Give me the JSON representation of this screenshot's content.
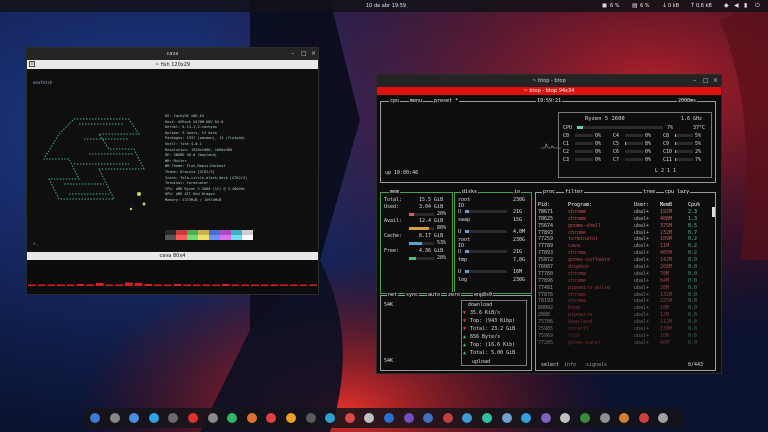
{
  "topbar": {
    "clock": "10 de abr  19:59",
    "indicators": [
      "6 %",
      "6 %",
      "0 kB",
      "0,6 kB"
    ]
  },
  "fish_window": {
    "title": "cava",
    "tab_title": "~ fish 120x29",
    "user_line": "neofetch",
    "cava_tab_title": "cava 80x4",
    "info_lines": [
      "OS: CachyOS x86_64",
      "Host: ASRock X470M-HDV R4.0",
      "Kernel: 6.14.1-2-cachyos",
      "Uptime: 9 hours, 51 mins",
      "Packages: 1937 (pacman), 13 (flatpak)",
      "Shell: fish 4.0.1",
      "Resolution: 1920x1080, 1600x900",
      "DE: GNOME 48.0 (Wayland)",
      "WM: Mutter",
      "WM Theme: Flat-Remix-Darkest",
      "Theme: Dracula [GTK2/3]",
      "Icons: Tela-circle-black-dark [GTK2/3]",
      "Terminal: terminator",
      "CPU: AMD Ryzen 5 2600 (12) @ 3.400GHz",
      "GPU: AMD ATI Red Dragon",
      "Memory: 2373MiB / 15974MiB"
    ],
    "palette": [
      "#2b2b2b",
      "#cc3b3b",
      "#4fae4f",
      "#c9b24a",
      "#4a6fd0",
      "#b04ac0",
      "#3fb0c0",
      "#cfcfcf",
      "#555555",
      "#ff5c5c",
      "#6fdf6f",
      "#f0e070",
      "#6f90ff",
      "#e070f0",
      "#70e0f0",
      "#ffffff"
    ],
    "cava_bars": [
      0.1,
      0.1,
      0.15,
      0.1,
      0.1,
      0.2,
      0.1,
      0.3,
      0.15,
      0.1,
      0.35,
      0.3,
      0.2,
      0.15,
      0.1,
      0.2,
      0.1,
      0.15,
      0.1,
      0.1,
      0.2,
      0.1,
      0.15,
      0.1,
      0.1,
      0.1,
      0.15,
      0.1,
      0.1,
      0.1
    ]
  },
  "btop_window": {
    "title": "~ btop - btop",
    "tab_title": "~ btop - btop 94x34",
    "cpu": {
      "label": "cpu",
      "menu": "menu",
      "preset": "preset *",
      "time": "19:59:21",
      "refresh": "2000ms",
      "model": "Ryzen 5 2600",
      "freq": "1.6 GHz",
      "total_label": "CPU",
      "total_pct": "7%",
      "temp": "37°C",
      "uptime": "up 10:00:46",
      "load": "L 2 1 1",
      "cores": [
        [
          "C0",
          "0%",
          "C4",
          "0%",
          "C8",
          "5%"
        ],
        [
          "C1",
          "0%",
          "C5",
          "8%",
          "C9",
          "5%"
        ],
        [
          "C2",
          "0%",
          "C6",
          "0%",
          "C10",
          "2%"
        ],
        [
          "C3",
          "0%",
          "C7",
          "0%",
          "C11",
          "7%"
        ]
      ]
    },
    "mem": {
      "label": "mem",
      "total_label": "Total:",
      "total": "15.5 GiB",
      "used_label": "Used:",
      "used": "3.04 GiB",
      "used_pct": "20%",
      "avail_label": "Avail:",
      "avail": "12.4 GiB",
      "avail_pct": "80%",
      "cache_label": "Cache:",
      "cache": "8.17 GiB",
      "cache_pct": "53%",
      "free_label": "Free:",
      "free": "4.36 GiB",
      "free_pct": "28%"
    },
    "disks": {
      "label": "disks",
      "io_label": "io",
      "items": [
        {
          "name": "root",
          "size": "230G",
          "io": "IO",
          "u_label": "U",
          "u_val": "21G"
        },
        {
          "name": "swap",
          "size": "15G",
          "io": "",
          "u_label": "U",
          "u_val": "4,0M"
        },
        {
          "name": "root",
          "size": "230G",
          "io": "IO",
          "u_label": "U",
          "u_val": "21G"
        },
        {
          "name": "tmp",
          "size": "7,8G",
          "io": "",
          "u_label": "U",
          "u_val": "16M"
        },
        {
          "name": "log",
          "size": "230G",
          "io": "",
          "u_label": "",
          "u_val": ""
        }
      ]
    },
    "net": {
      "label": "net",
      "sync": "sync",
      "auto": "auto",
      "zero": "zero",
      "iface": "enp8s0",
      "scale_top": "54K",
      "scale_bottom": "54K",
      "download": "download",
      "dl_rate": "35.6 KiB/s",
      "dl_top": "Top: (943 Kibp)",
      "dl_total": "Total: 23.2 GiB",
      "ul_rate": "656 Byte/s",
      "ul_top": "Top: (16.6 Kib)",
      "ul_total": "Total: 5.00 GiB",
      "upload": "upload"
    },
    "proc": {
      "label": "proc",
      "filter": "filter",
      "tree": "tree",
      "sort": "cpu lazy",
      "headers": [
        "Pid:",
        "Program:",
        "User:",
        "MemB",
        "Cpu%"
      ],
      "rows": [
        [
          "78671",
          "chrome",
          "ubal+",
          "192M",
          "2.3"
        ],
        [
          "78625",
          "chrome",
          "ubal+",
          "408M",
          "1.3"
        ],
        [
          "75674",
          "gnome-shell",
          "ubal+",
          "375M",
          "0.5"
        ],
        [
          "77893",
          "chrome",
          "ubal+",
          "232M",
          "0.7"
        ],
        [
          "77259",
          "terminator",
          "ubal+",
          "109M",
          "0.2"
        ],
        [
          "77789",
          "cava",
          "ubal+",
          "11M",
          "0.2"
        ],
        [
          "77893",
          "chrome",
          "ubal+",
          "405M",
          "0.2"
        ],
        [
          "75872",
          "gnome-software",
          "ubal+",
          "142M",
          "0.0"
        ],
        [
          "76087",
          "dropbox",
          "ubal+",
          "268M",
          "0.0"
        ],
        [
          "77760",
          "chrome",
          "ubal+",
          "70M",
          "0.0"
        ],
        [
          "77896",
          "chrome",
          "ubal+",
          "84M",
          "0.0"
        ],
        [
          "77481",
          "pipewire-pulse",
          "ubal+",
          "28M",
          "0.0"
        ],
        [
          "77876",
          "chrome",
          "ubal+",
          "132M",
          "0.0"
        ],
        [
          "78193",
          "chrome",
          "ubal+",
          "225M",
          "0.0"
        ],
        [
          "80092",
          "btop",
          "ubal+",
          "10M",
          "0.0"
        ],
        [
          "2086",
          "pipewire",
          "ubal+",
          "12M",
          "0.0"
        ],
        [
          "75706",
          "Xwayland",
          "ubal+",
          "112M",
          "0.0"
        ],
        [
          "75905",
          "corectl",
          "ubal+",
          "130M",
          "0.0"
        ],
        [
          "75969",
          "fish",
          "ubal+",
          "10M",
          "0.0"
        ],
        [
          "77205",
          "gnome-panel",
          "ubal+",
          "40M",
          "0.0"
        ]
      ],
      "select": "select",
      "info": "info",
      "signals": "signals",
      "count": "0/443"
    }
  },
  "dock": {
    "icons": [
      "#3a7bd5",
      "#888888",
      "#4a90e2",
      "#2fa0e0",
      "#6b6b6b",
      "#e03030",
      "#8a8a8a",
      "#34b36a",
      "#e07030",
      "#e04040",
      "#f0a020",
      "#5a5a5a",
      "#30a0d0",
      "#e04848",
      "#c0c0c0",
      "#2d6fd0",
      "#7050c0",
      "#4070c0",
      "#c04040",
      "#3a9bd5",
      "#30c0a0",
      "#70a0d0",
      "#2fa0e0",
      "#8060c0",
      "#c0c0c0",
      "#3a8a3a",
      "#909090",
      "#d08030",
      "#d04040",
      "#a0a0a0"
    ]
  }
}
